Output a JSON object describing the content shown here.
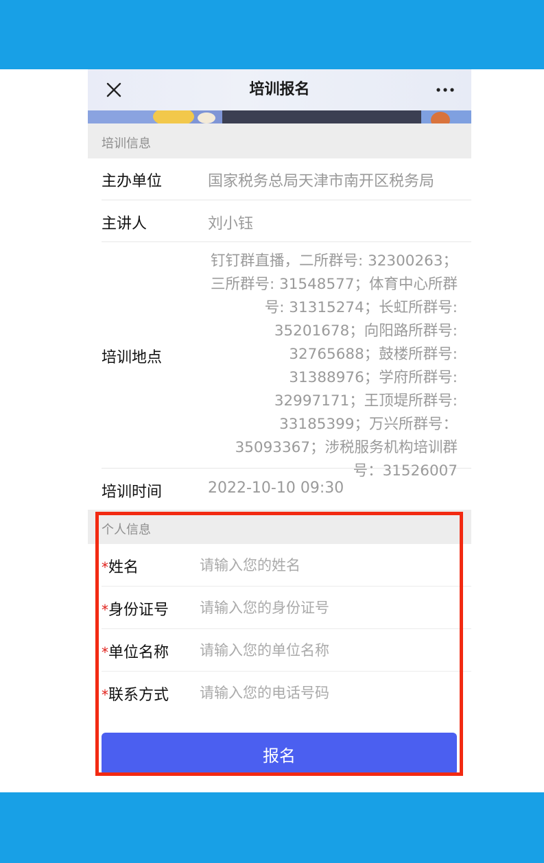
{
  "nav": {
    "title": "培训报名"
  },
  "training_info": {
    "section_title": "培训信息",
    "rows": [
      {
        "label": "主办单位",
        "value": "国家税务总局天津市南开区税务局"
      },
      {
        "label": "主讲人",
        "value": "刘小钰"
      },
      {
        "label": "培训地点",
        "value": "钉钉群直播，二所群号: 32300263；三所群号: 31548577；体育中心所群号: 31315274；长虹所群号: 35201678；向阳路所群号: 32765688；鼓楼所群号: 31388976；学府所群号: 32997171；王顶堤所群号: 33185399；万兴所群号：35093367；涉税服务机构培训群号：31526007"
      },
      {
        "label": "培训时间",
        "value": "2022-10-10 09:30"
      }
    ]
  },
  "personal_info": {
    "section_title": "个人信息",
    "required_mark": "*",
    "fields": [
      {
        "label": "姓名",
        "placeholder": "请输入您的姓名"
      },
      {
        "label": "身份证号",
        "placeholder": "请输入您的身份证号"
      },
      {
        "label": "单位名称",
        "placeholder": "请输入您的单位名称"
      },
      {
        "label": "联系方式",
        "placeholder": "请输入您的电话号码"
      }
    ],
    "submit_label": "报名"
  },
  "colors": {
    "brand_band": "#18a0e6",
    "button": "#4b5ff0",
    "required": "#e0201a",
    "highlight": "#f22a12"
  }
}
